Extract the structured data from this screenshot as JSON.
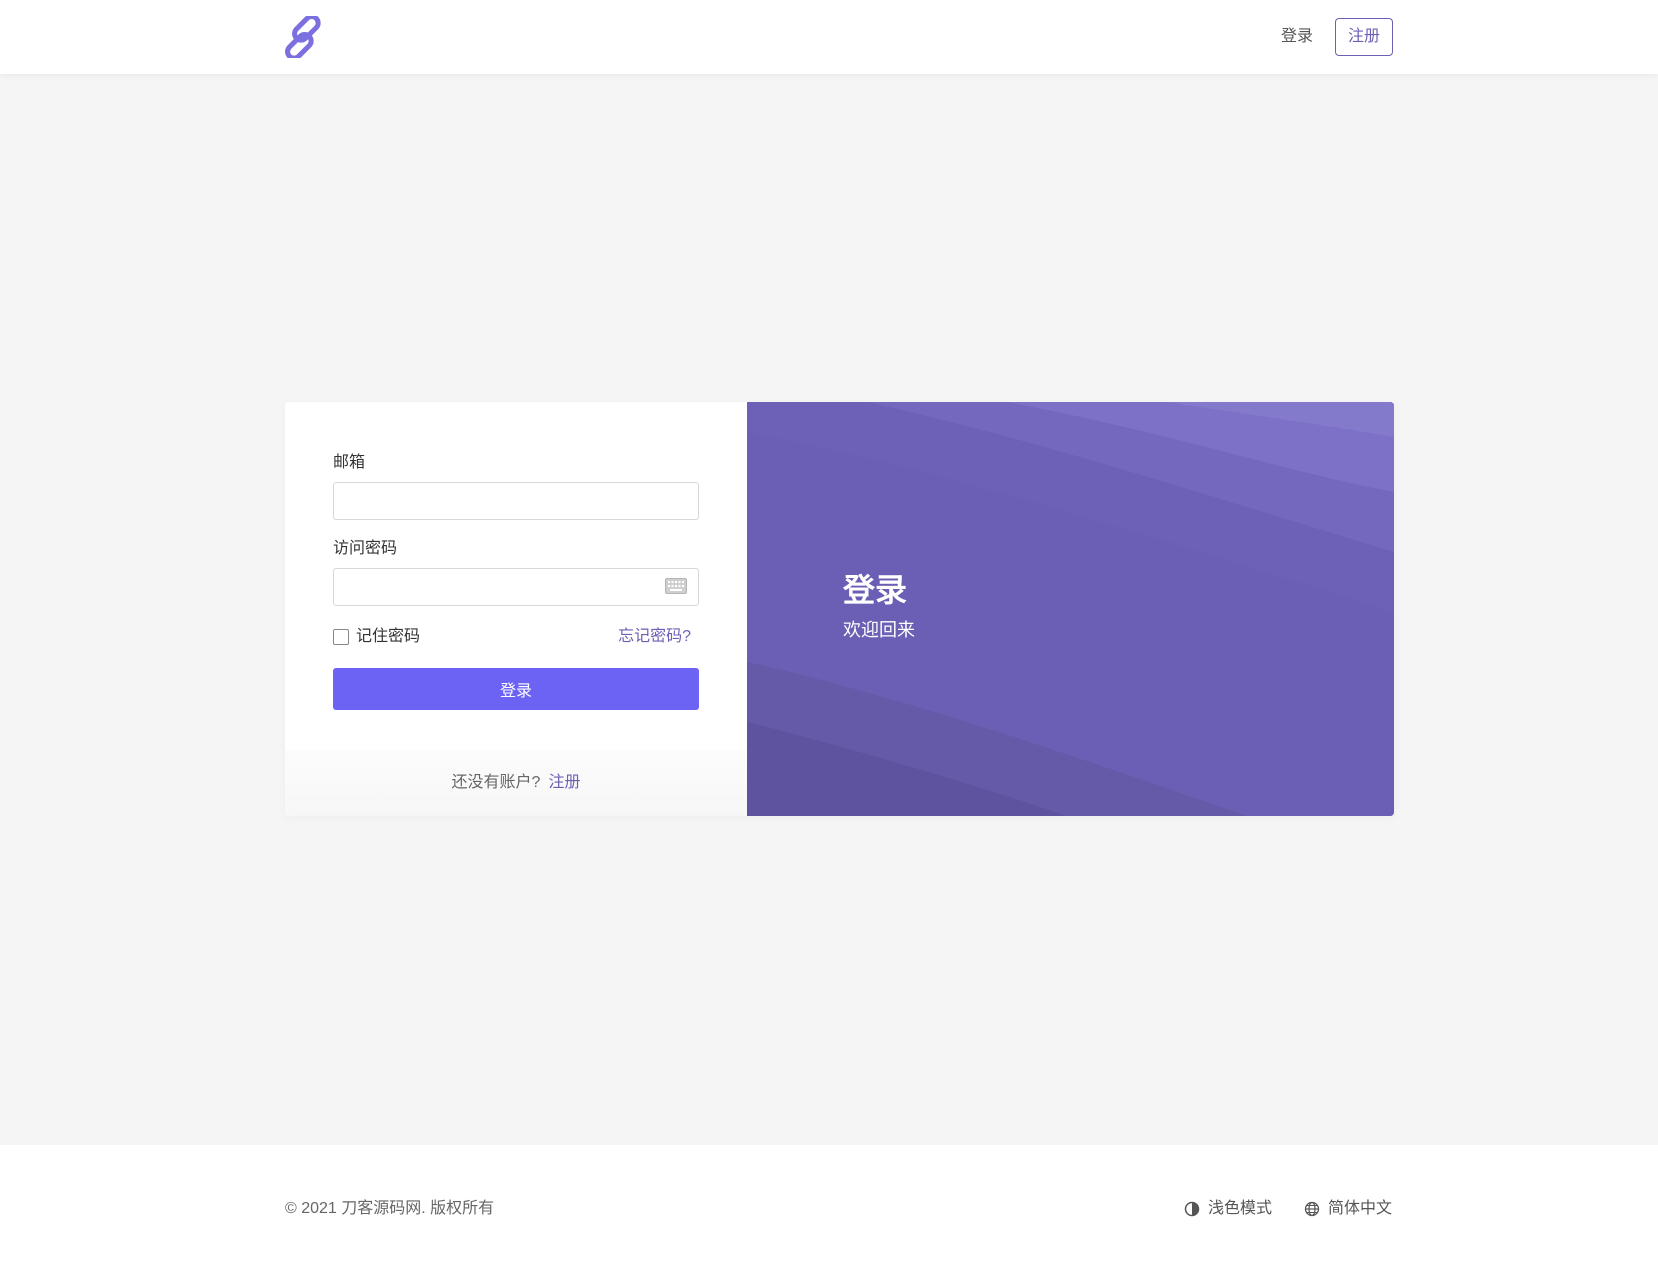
{
  "navbar": {
    "login_label": "登录",
    "register_label": "注册",
    "logo_icon": "link-icon",
    "accent_color": "#6b5fb5"
  },
  "form": {
    "email_label": "邮箱",
    "email_value": "",
    "password_label": "访问密码",
    "password_value": "",
    "keyboard_icon": "keyboard-icon",
    "remember_label": "记住密码",
    "remember_checked": false,
    "forgot_label": "忘记密码?",
    "submit_label": "登录",
    "submit_color": "#6c63f5",
    "no_account_text": "还没有账户?",
    "register_link": "注册"
  },
  "hero": {
    "title": "登录",
    "subtitle": "欢迎回来",
    "background_color": "#6a5fb4"
  },
  "footer": {
    "copyright": "© 2021 刀客源码网. 版权所有",
    "theme_label": "浅色模式",
    "theme_icon": "contrast-icon",
    "language_label": "简体中文",
    "language_icon": "globe-icon"
  }
}
